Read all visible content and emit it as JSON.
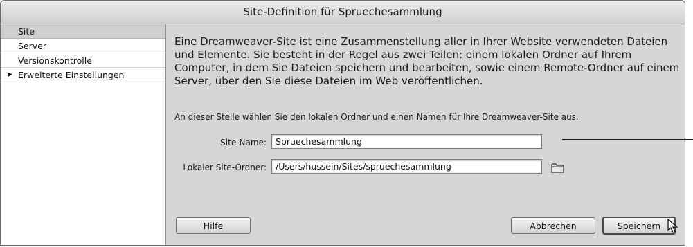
{
  "window": {
    "title": "Site-Definition für Spruechesammlung"
  },
  "sidebar": {
    "items": [
      {
        "label": "Site",
        "selected": true,
        "expandable": false
      },
      {
        "label": "Server",
        "selected": false,
        "expandable": false
      },
      {
        "label": "Versionskontrolle",
        "selected": false,
        "expandable": false
      },
      {
        "label": "Erweiterte Einstellungen",
        "selected": false,
        "expandable": true,
        "arrow": "▶"
      }
    ]
  },
  "content": {
    "intro": "Eine Dreamweaver-Site ist eine Zusammenstellung aller in Ihrer Website verwendeten Dateien und Elemente. Sie besteht in der Regel aus zwei Teilen: einem lokalen Ordner auf Ihrem Computer, in dem Sie Dateien speichern und bearbeiten, sowie einem Remote-Ordner auf einem Server, über den Sie diese Dateien im Web veröffentlichen.",
    "instruction": "An dieser Stelle wählen Sie den lokalen Ordner und einen Namen für Ihre Dreamweaver-Site aus.",
    "site_name": {
      "label": "Site-Name:",
      "value": "Spruechesammlung"
    },
    "local_folder": {
      "label": "Lokaler Site-Ordner:",
      "value": "/Users/hussein/Sites/spruechesammlung",
      "icon": "folder-icon"
    }
  },
  "buttons": {
    "help": "Hilfe",
    "cancel": "Abbrechen",
    "save": "Speichern"
  },
  "colors": {
    "dialog_bg": "#d6d6d6",
    "sidebar_bg": "#ffffff",
    "selected_bg": "#d0d0d0"
  }
}
